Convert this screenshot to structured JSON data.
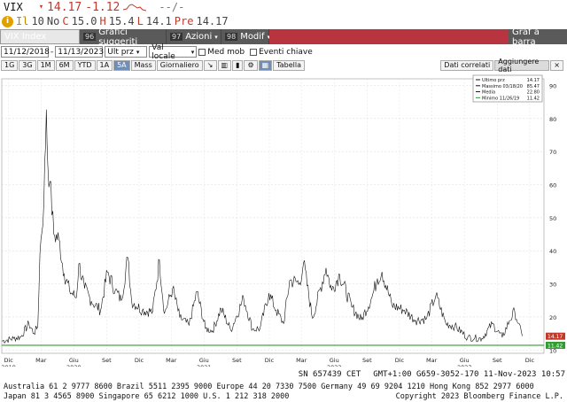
{
  "ticker": {
    "symbol": "VIX",
    "last": "14.17",
    "change": "-1.12",
    "suffix": "--/-",
    "line2": {
      "il": "Il",
      "il_val": "10",
      "no": "No",
      "c_lbl": "C",
      "c_val": "15.0",
      "h_lbl": "H",
      "h_val": "15.4",
      "l_lbl": "L",
      "l_val": "14.1",
      "pre_lbl": "Pre",
      "pre_val": "14.17"
    }
  },
  "toolbar": {
    "index": "VIX Index",
    "suggested_num": "96",
    "suggested": "Grafici suggeriti",
    "actions_num": "97",
    "actions": "Azioni",
    "edit_num": "98",
    "edit": "Modif",
    "chart_type": "Graf a barra"
  },
  "controls": {
    "start_date": "11/12/2018",
    "end_date": "11/13/2023",
    "field": "Ult prz",
    "currency": "Val locale",
    "mov_avg": "Med mob",
    "events": "Eventi chiave"
  },
  "periods": {
    "items": [
      "1G",
      "3G",
      "1M",
      "6M",
      "YTD",
      "1A",
      "5A",
      "Mass"
    ],
    "active": "5A",
    "frequency": "Giornaliero",
    "table": "Tabella",
    "correlated": "Dati correlati",
    "add_data": "Aggiungere dati"
  },
  "footer": {
    "sn": "SN 657439 CET",
    "gmt": "GMT+1:00 G659-3052-170 11-Nov-2023 10:57",
    "line2": "Australia 61 2 9777 8600 Brazil 5511 2395 9000 Europe 44 20 7330 7500 Germany 49 69 9204 1210 Hong Kong 852 2977 6000",
    "line3_left": "Japan 81 3 4565 8900        Singapore 65 6212 1000       U.S. 1 212 318 2000",
    "line3_right": "Copyright 2023 Bloomberg Finance L.P."
  },
  "colors": {
    "price_line": "#111111",
    "min_line": "#2e9e2e",
    "last_tag": "#c0392b",
    "red_bar": "#b8353f"
  },
  "chart_data": {
    "type": "line",
    "title": "",
    "xlabel": "",
    "ylabel": "",
    "ylim": [
      9,
      92
    ],
    "yticks": [
      10,
      20,
      30,
      40,
      50,
      60,
      70,
      80,
      90
    ],
    "x_tick_labels": [
      {
        "date": "2019-12-01",
        "label": "Dic"
      },
      {
        "date": "2020-03-01",
        "label": "Mar"
      },
      {
        "date": "2020-06-01",
        "label": "Giu"
      },
      {
        "date": "2020-09-01",
        "label": "Set"
      },
      {
        "date": "2020-12-01",
        "label": "Dic"
      },
      {
        "date": "2021-03-01",
        "label": "Mar"
      },
      {
        "date": "2021-06-01",
        "label": "Giu"
      },
      {
        "date": "2021-09-01",
        "label": "Set"
      },
      {
        "date": "2021-12-01",
        "label": "Dic"
      },
      {
        "date": "2022-03-01",
        "label": "Mar"
      },
      {
        "date": "2022-06-01",
        "label": "Giu"
      },
      {
        "date": "2022-09-01",
        "label": "Set"
      },
      {
        "date": "2022-12-01",
        "label": "Dic"
      },
      {
        "date": "2023-03-01",
        "label": "Mar"
      },
      {
        "date": "2023-06-01",
        "label": "Giu"
      },
      {
        "date": "2023-09-01",
        "label": "Set"
      },
      {
        "date": "2023-12-01",
        "label": "Dic"
      }
    ],
    "year_labels": [
      {
        "date": "2019-12-01",
        "label": "2019"
      },
      {
        "date": "2020-06-01",
        "label": "2020"
      },
      {
        "date": "2021-06-01",
        "label": "2021"
      },
      {
        "date": "2022-06-01",
        "label": "2022"
      },
      {
        "date": "2023-06-01",
        "label": "2023"
      }
    ],
    "x_range": [
      "2019-11-12",
      "2024-01-10"
    ],
    "series": [
      {
        "points": [
          [
            "2019-11-12",
            12.7
          ],
          [
            "2019-12-15",
            13.5
          ],
          [
            "2020-01-05",
            14.0
          ],
          [
            "2020-01-27",
            18.0
          ],
          [
            "2020-02-10",
            15.0
          ],
          [
            "2020-02-21",
            17.1
          ],
          [
            "2020-02-27",
            39.2
          ],
          [
            "2020-03-09",
            54.5
          ],
          [
            "2020-03-16",
            82.7
          ],
          [
            "2020-03-20",
            66.0
          ],
          [
            "2020-03-26",
            61.0
          ],
          [
            "2020-04-06",
            45.0
          ],
          [
            "2020-04-20",
            43.5
          ],
          [
            "2020-05-05",
            33.0
          ],
          [
            "2020-05-20",
            28.0
          ],
          [
            "2020-06-08",
            25.8
          ],
          [
            "2020-06-15",
            36.1
          ],
          [
            "2020-07-01",
            28.6
          ],
          [
            "2020-07-20",
            24.8
          ],
          [
            "2020-08-15",
            22.0
          ],
          [
            "2020-09-03",
            33.6
          ],
          [
            "2020-09-25",
            28.0
          ],
          [
            "2020-10-12",
            25.0
          ],
          [
            "2020-10-30",
            38.0
          ],
          [
            "2020-11-10",
            24.8
          ],
          [
            "2020-12-10",
            22.0
          ],
          [
            "2021-01-08",
            21.6
          ],
          [
            "2021-01-27",
            37.2
          ],
          [
            "2021-02-10",
            21.0
          ],
          [
            "2021-03-05",
            28.6
          ],
          [
            "2021-03-25",
            19.8
          ],
          [
            "2021-04-20",
            17.5
          ],
          [
            "2021-05-12",
            27.6
          ],
          [
            "2021-06-05",
            16.5
          ],
          [
            "2021-06-25",
            15.8
          ],
          [
            "2021-07-19",
            22.5
          ],
          [
            "2021-08-15",
            16.0
          ],
          [
            "2021-09-20",
            25.7
          ],
          [
            "2021-10-15",
            16.3
          ],
          [
            "2021-11-05",
            16.5
          ],
          [
            "2021-11-30",
            27.2
          ],
          [
            "2021-12-20",
            22.0
          ],
          [
            "2022-01-10",
            18.0
          ],
          [
            "2022-01-27",
            31.0
          ],
          [
            "2022-02-24",
            30.3
          ],
          [
            "2022-03-07",
            36.4
          ],
          [
            "2022-04-01",
            19.6
          ],
          [
            "2022-05-09",
            34.8
          ],
          [
            "2022-05-25",
            28.0
          ],
          [
            "2022-06-16",
            32.9
          ],
          [
            "2022-07-20",
            23.0
          ],
          [
            "2022-08-16",
            19.1
          ],
          [
            "2022-09-15",
            26.0
          ],
          [
            "2022-09-30",
            31.6
          ],
          [
            "2022-10-13",
            33.6
          ],
          [
            "2022-11-10",
            23.5
          ],
          [
            "2022-12-15",
            22.0
          ],
          [
            "2023-01-15",
            19.0
          ],
          [
            "2023-02-15",
            19.5
          ],
          [
            "2023-03-13",
            26.5
          ],
          [
            "2023-04-10",
            18.0
          ],
          [
            "2023-05-05",
            17.2
          ],
          [
            "2023-06-10",
            13.8
          ],
          [
            "2023-06-30",
            13.6
          ],
          [
            "2023-07-20",
            13.5
          ],
          [
            "2023-08-18",
            17.9
          ],
          [
            "2023-09-15",
            13.8
          ],
          [
            "2023-10-05",
            18.8
          ],
          [
            "2023-10-20",
            21.7
          ],
          [
            "2023-10-30",
            18.0
          ],
          [
            "2023-11-10",
            14.2
          ]
        ]
      }
    ],
    "min_line": 11.42,
    "last_value_tag": "14.17",
    "min_value_tag": "11.42",
    "legend": {
      "position": "top-right",
      "entries": [
        {
          "label": "Ultimo prz",
          "value": "14.17"
        },
        {
          "label": "Massimo 03/18/20",
          "value": "85.47"
        },
        {
          "label": "Media",
          "value": "22.80"
        },
        {
          "label": "Minimo 11/26/19",
          "value": "11.42"
        }
      ]
    }
  }
}
